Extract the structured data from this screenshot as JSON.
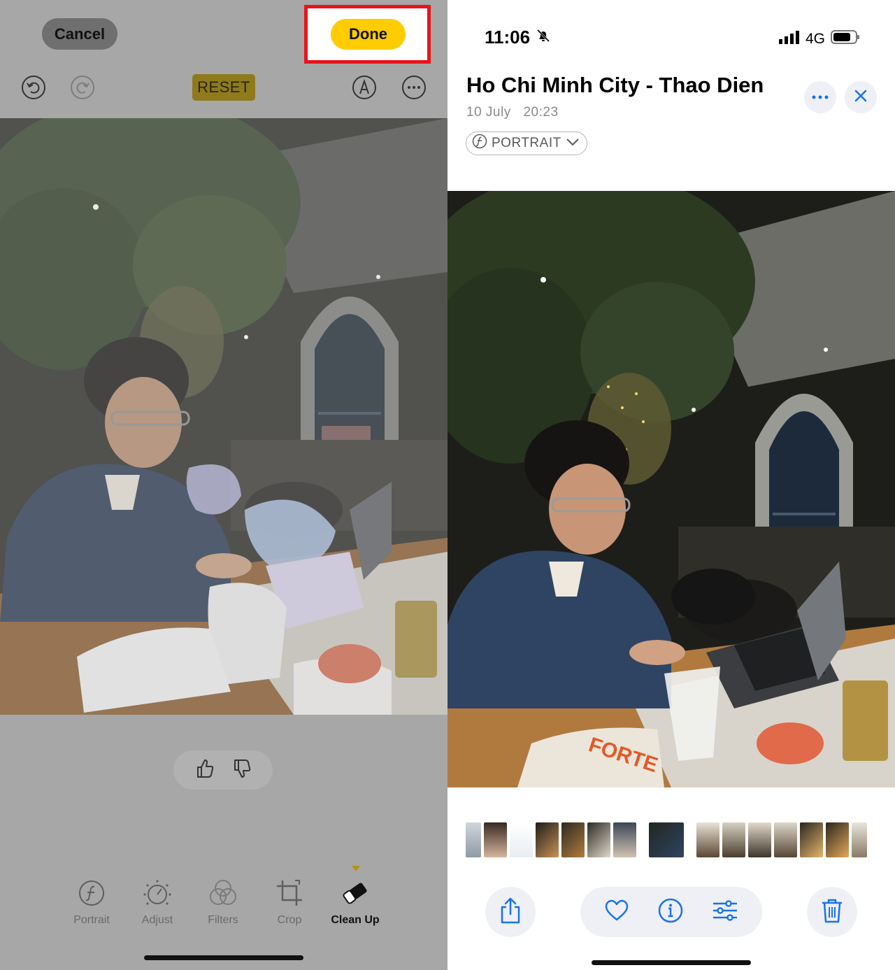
{
  "edit_view": {
    "cancel_label": "Cancel",
    "done_label": "Done",
    "reset_label": "RESET",
    "tabs": [
      {
        "label": "Portrait",
        "icon": "portrait-f-icon"
      },
      {
        "label": "Adjust",
        "icon": "adjust-dial-icon"
      },
      {
        "label": "Filters",
        "icon": "filters-circles-icon"
      },
      {
        "label": "Crop",
        "icon": "crop-icon"
      },
      {
        "label": "Clean Up",
        "icon": "eraser-icon"
      }
    ],
    "active_tab": "Clean Up",
    "highlight_color": "#e8141a",
    "accent_color": "#ffcc00"
  },
  "detail_view": {
    "status": {
      "time": "11:06",
      "network": "4G"
    },
    "title": "Ho Chi Minh City - Thao Dien",
    "date": "10 July",
    "time": "20:23",
    "mode_label": "PORTRAIT",
    "accent_color": "#1a73e8"
  }
}
